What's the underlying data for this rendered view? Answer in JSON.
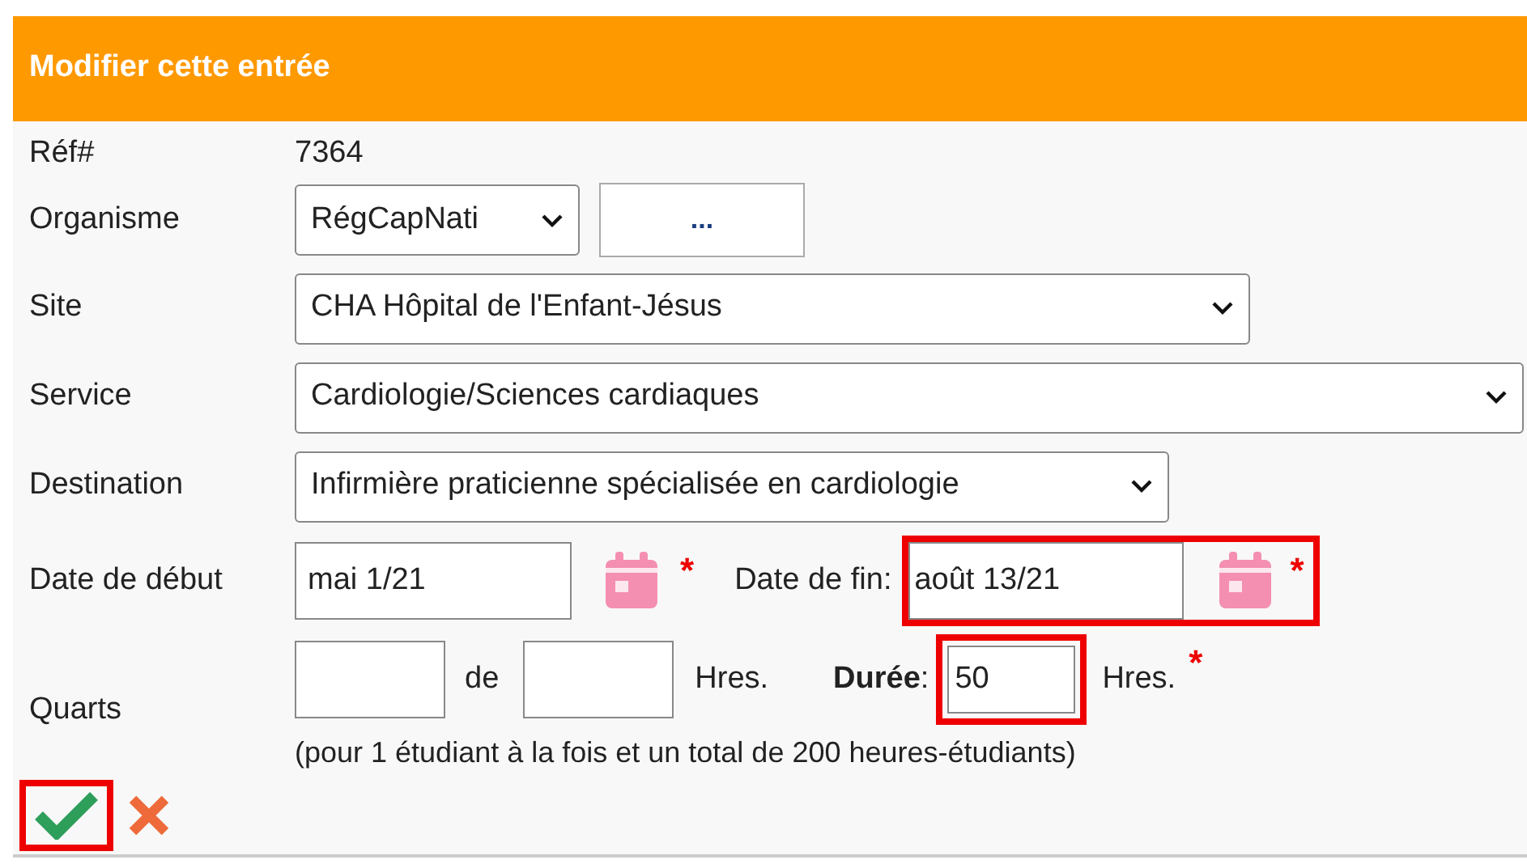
{
  "dialog": {
    "title": "Modifier cette entrée"
  },
  "ref": {
    "label": "Réf#",
    "value": "7364"
  },
  "organisme": {
    "label": "Organisme",
    "value": "RégCapNati",
    "button": "..."
  },
  "selects": [
    {
      "label": "Site",
      "value": "CHA Hôpital de l'Enfant-Jésus"
    },
    {
      "label": "Service",
      "value": "Cardiologie/Sciences cardiaques"
    },
    {
      "label": "Destination",
      "value": "Infirmière praticienne spécialisée en cardiologie"
    }
  ],
  "dates": {
    "label": "Date de début",
    "start": {
      "value": "mai 1/21",
      "required": "*",
      "highlighted": false
    },
    "end_label": "Date de fin:",
    "end": {
      "value": "août 13/21",
      "required": "*",
      "highlighted": true
    }
  },
  "shifts": {
    "label": "Quarts",
    "connector": "de",
    "unit": "Hres.",
    "duration_label": "Durée",
    "duration_suffix": ":",
    "duration": {
      "value": "50",
      "highlighted": true
    },
    "duration_unit": "Hres.",
    "required": "*",
    "note": "(pour 1 étudiant à la fois et un total de 200 heures-étudiants)"
  },
  "actions": [
    {
      "kind": "save",
      "highlighted": true
    },
    {
      "kind": "cancel",
      "highlighted": false
    }
  ]
}
